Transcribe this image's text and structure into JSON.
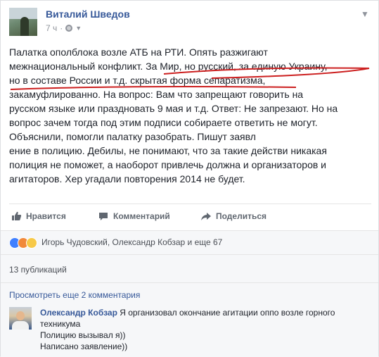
{
  "post": {
    "author": "Виталий Шведов",
    "time": "7 ч",
    "privacy_icon": "globe-icon",
    "options_icon": "chevron-down-icon",
    "text_lines": [
      "Палатка ополблока возле АТБ на РТИ. Опять разжигают",
      "межнациональный конфликт. За Мир, но русский, за единую Украину,",
      "но в составе России и т.д. скрытая форма сепаратизма,",
      "закамуфлированно. На вопрос: Вам что запрещают говорить на",
      "русском языке или праздновать 9 мая и т.д. Ответ: Не запрезают. Но на",
      "вопрос зачем тогда под этим подписи собираете ответить не могут.",
      "Объяснили, помогли палатку разобрать. Пишут заявл",
      "ение в полицию. Дебилы, не понимают, что за такие действи никакая",
      "полиция не поможет, а наоборот привлечь должна и организаторов и",
      "агитаторов. Хер угадали повторения 2014 не будет."
    ],
    "underline_color": "#cc1f1f"
  },
  "actions": {
    "like_label": "Нравится",
    "comment_label": "Комментарий",
    "share_label": "Поделиться"
  },
  "reactions": {
    "icons": [
      "like-reaction-icon",
      "angry-reaction-icon",
      "wow-reaction-icon"
    ],
    "text": "Игорь Чудовский, Олександр Кобзар и еще 67"
  },
  "shares": {
    "text": "13 публикаций"
  },
  "comments": {
    "view_more": "Просмотреть еще 2 комментария",
    "items": [
      {
        "author": "Олександр Кобзар",
        "lines": [
          "Я организовал окончание агитации оппо возле горного",
          "техникума",
          "Полицию вызывал я))",
          "Написано заявление))"
        ]
      }
    ]
  },
  "colors": {
    "link": "#365899",
    "text": "#1d2129",
    "muted": "#90949c",
    "like": "#4080ff",
    "angry": "#f1893a",
    "wow": "#f7c948"
  }
}
